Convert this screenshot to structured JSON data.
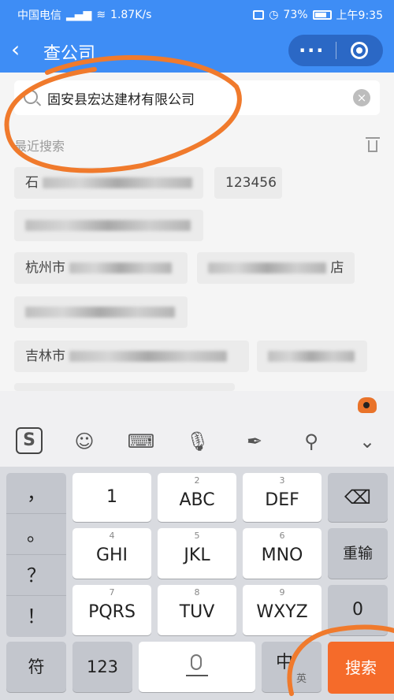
{
  "status_bar": {
    "carrier": "中国电信",
    "net_speed": "1.87K/s",
    "battery": "73%",
    "time": "上午9:35"
  },
  "nav": {
    "back_icon": "‹",
    "title": "查公司",
    "more_label": "···"
  },
  "search": {
    "value": "固安县宏达建材有限公司",
    "clear_icon": "×"
  },
  "history": {
    "title": "最近搜索",
    "chips": [
      {
        "prefix": "石",
        "suffix": ""
      },
      {
        "prefix": "",
        "suffix": "123456"
      },
      {
        "prefix": "",
        "suffix": ""
      },
      {
        "prefix": "杭州市",
        "suffix": ""
      },
      {
        "prefix": "",
        "suffix": "店"
      },
      {
        "prefix": "",
        "suffix": ""
      },
      {
        "prefix": "吉林市",
        "suffix": ""
      },
      {
        "prefix": "",
        "suffix": ""
      }
    ]
  },
  "keyboard": {
    "toolbar_icons": [
      "sogou-logo-icon",
      "emoji-icon",
      "keyboard-icon",
      "microphone-icon",
      "handwriting-icon",
      "search-icon",
      "collapse-icon"
    ],
    "sogou_label": "S",
    "punctuation": [
      "，",
      "。",
      "？",
      "！"
    ],
    "keys": [
      {
        "num": "1",
        "label": "1",
        "show_num": false
      },
      {
        "num": "2",
        "label": "ABC"
      },
      {
        "num": "3",
        "label": "DEF"
      },
      {
        "num": "4",
        "label": "GHI"
      },
      {
        "num": "5",
        "label": "JKL"
      },
      {
        "num": "6",
        "label": "MNO"
      },
      {
        "num": "7",
        "label": "PQRS"
      },
      {
        "num": "8",
        "label": "TUV"
      },
      {
        "num": "9",
        "label": "WXYZ"
      }
    ],
    "delete_icon": "⌫",
    "reenter_label": "重输",
    "zero_label": "0",
    "symbol_label": "符",
    "num_label": "123",
    "lang_main": "中",
    "lang_sub": "英",
    "search_label": "搜索"
  },
  "colors": {
    "brand_blue": "#3e8df5",
    "search_orange": "#f56b2a",
    "annotation_orange": "#f07a2c"
  }
}
